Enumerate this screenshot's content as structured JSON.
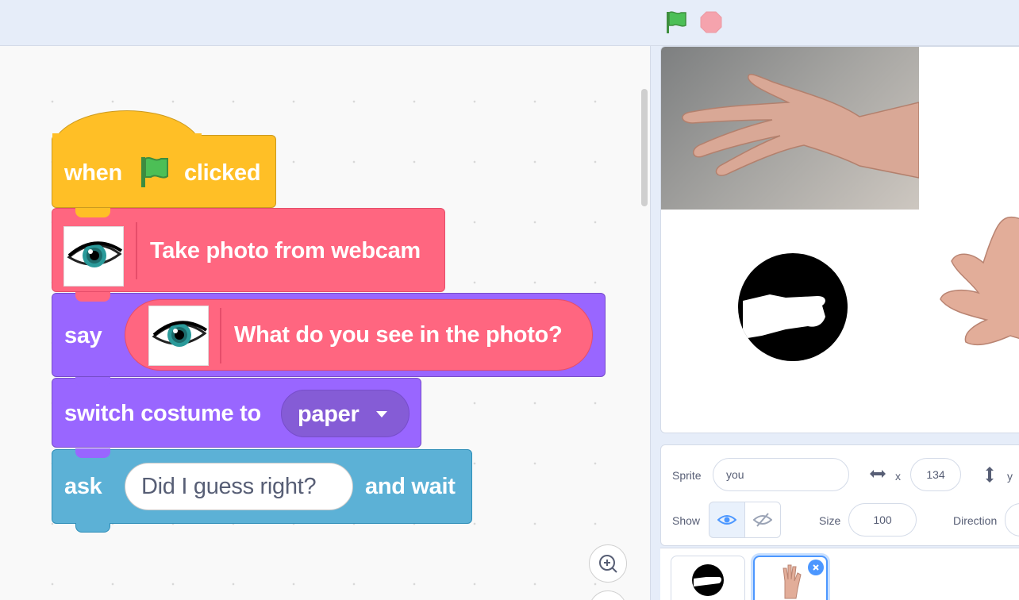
{
  "toolbar": {
    "green_flag": "green-flag-icon",
    "stop": "stop-icon"
  },
  "blocks": {
    "hat": {
      "word1": "when",
      "word2": "clicked",
      "color": "#ffbf26"
    },
    "take_photo": {
      "label": "Take photo from webcam",
      "color": "#ff6680"
    },
    "say": {
      "label": "say",
      "inner": "What do you see in the photo?",
      "color": "#9966ff"
    },
    "switch_costume": {
      "label": "switch costume to",
      "value": "paper"
    },
    "ask": {
      "label": "ask",
      "input": "Did I guess right?",
      "suffix": "and wait",
      "color": "#5cb1d6"
    }
  },
  "sprite_info": {
    "sprite_label": "Sprite",
    "sprite_name": "you",
    "x_label": "x",
    "x_value": "134",
    "y_label": "y",
    "show_label": "Show",
    "size_label": "Size",
    "size_value": "100",
    "direction_label": "Direction"
  },
  "colors": {
    "accent": "#4c97ff",
    "stage_bg": "#ffffff",
    "workspace_bg": "#f9f9f9"
  }
}
